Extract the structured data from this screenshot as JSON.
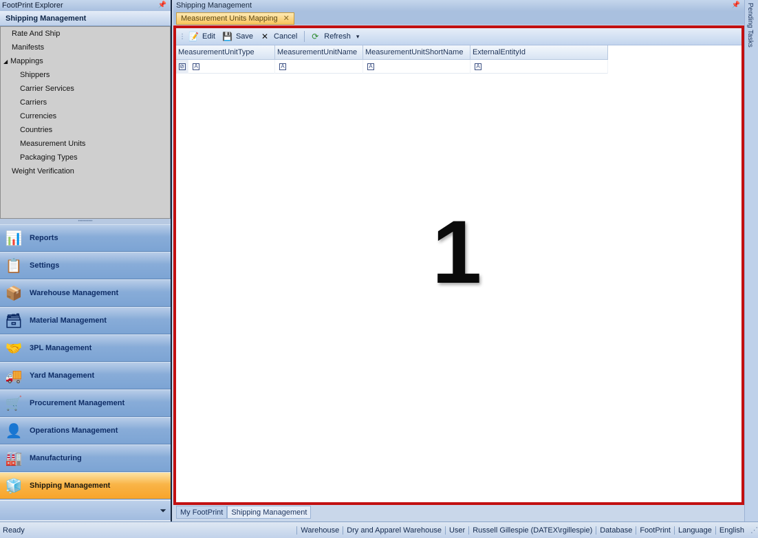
{
  "explorer": {
    "title": "FootPrint Explorer",
    "section": "Shipping Management",
    "tree": [
      {
        "label": "Rate And Ship",
        "level": 1
      },
      {
        "label": "Manifests",
        "level": 1
      },
      {
        "label": "Mappings",
        "level": 1,
        "expanded": true
      },
      {
        "label": "Shippers",
        "level": 2
      },
      {
        "label": "Carrier Services",
        "level": 2
      },
      {
        "label": "Carriers",
        "level": 2
      },
      {
        "label": "Currencies",
        "level": 2
      },
      {
        "label": "Countries",
        "level": 2
      },
      {
        "label": "Measurement Units",
        "level": 2
      },
      {
        "label": "Packaging Types",
        "level": 2
      },
      {
        "label": "Weight Verification",
        "level": 1
      }
    ],
    "nav": [
      {
        "label": "Reports",
        "icon": "reports-icon"
      },
      {
        "label": "Settings",
        "icon": "settings-icon"
      },
      {
        "label": "Warehouse Management",
        "icon": "warehouse-icon"
      },
      {
        "label": "Material Management",
        "icon": "material-icon"
      },
      {
        "label": "3PL Management",
        "icon": "3pl-icon"
      },
      {
        "label": "Yard Management",
        "icon": "yard-icon"
      },
      {
        "label": "Procurement Management",
        "icon": "procurement-icon"
      },
      {
        "label": "Operations Management",
        "icon": "operations-icon"
      },
      {
        "label": "Manufacturing",
        "icon": "manufacturing-icon"
      },
      {
        "label": "Shipping Management",
        "icon": "shipping-icon",
        "active": true
      }
    ]
  },
  "main": {
    "title": "Shipping Management",
    "tab": "Measurement Units Mapping",
    "toolbar": {
      "edit": "Edit",
      "save": "Save",
      "cancel": "Cancel",
      "refresh": "Refresh"
    },
    "grid": {
      "columns": [
        "MeasurementUnitType",
        "MeasurementUnitName",
        "MeasurementUnitShortName",
        "ExternalEntityId"
      ]
    },
    "callout": "1",
    "bottom_tabs": [
      "My FootPrint",
      "Shipping Management"
    ]
  },
  "side_rail": {
    "label": "Pending Tasks"
  },
  "status": {
    "ready": "Ready",
    "warehouse_label": "Warehouse",
    "warehouse_value": "Dry and Apparel Warehouse",
    "user_label": "User",
    "user_value": "Russell Gillespie (DATEX\\rgillespie)",
    "database_label": "Database",
    "database_value": "FootPrint",
    "language_label": "Language",
    "language_value": "English"
  },
  "colors": {
    "accent_border": "#c21011",
    "active_nav": "#f9b447",
    "nav_blue": "#88acd8"
  }
}
